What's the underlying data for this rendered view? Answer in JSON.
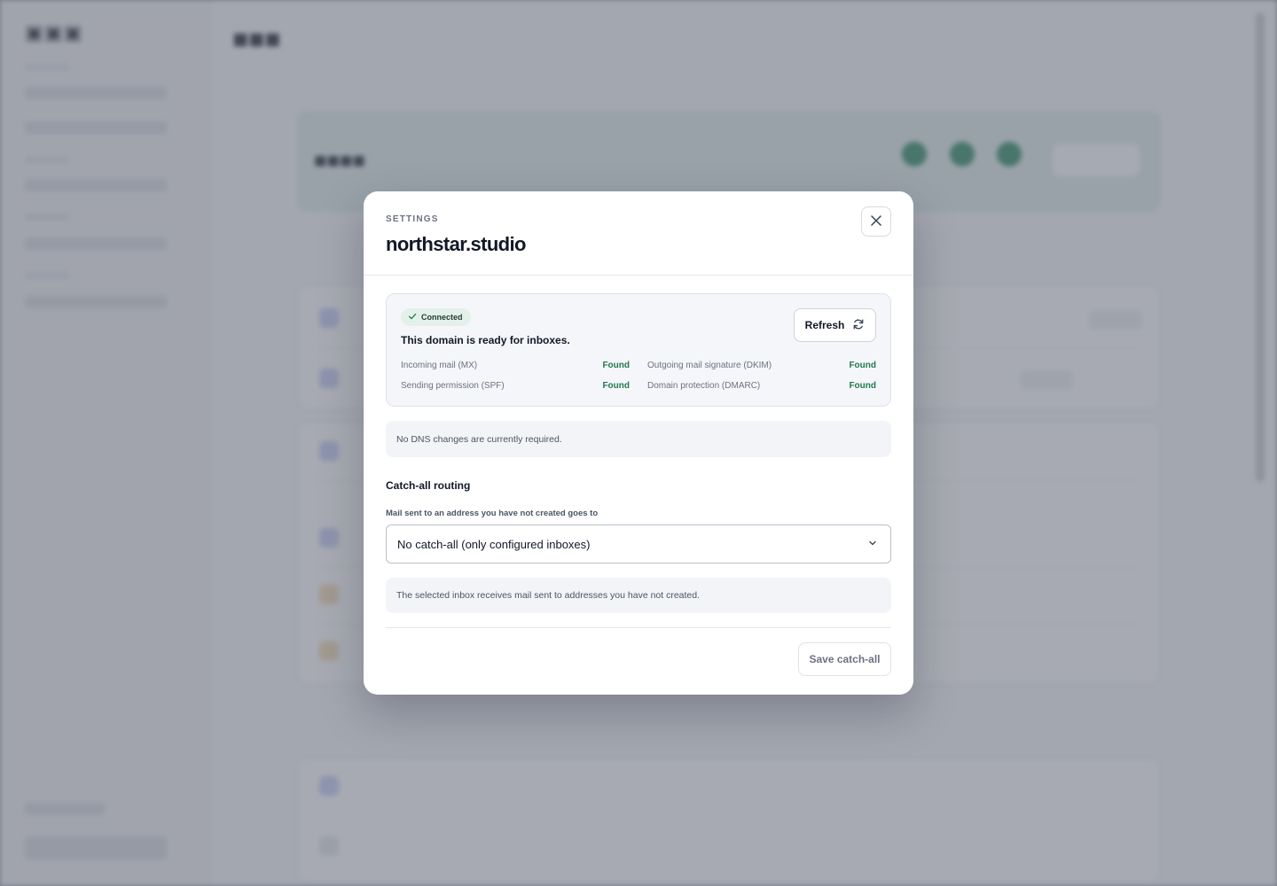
{
  "modal": {
    "eyebrow": "SETTINGS",
    "title": "northstar.studio",
    "close_icon": "close-icon"
  },
  "status": {
    "badge": "Connected",
    "badge_icon": "check-icon",
    "headline": "This domain is ready for inboxes.",
    "refresh_label": "Refresh",
    "refresh_icon": "refresh-icon",
    "checks": [
      {
        "label": "Incoming mail (MX)",
        "value": "Found"
      },
      {
        "label": "Outgoing mail signature (DKIM)",
        "value": "Found"
      },
      {
        "label": "Sending permission (SPF)",
        "value": "Found"
      },
      {
        "label": "Domain protection (DMARC)",
        "value": "Found"
      }
    ]
  },
  "dns_note": "No DNS changes are currently required.",
  "catch_all": {
    "title": "Catch-all routing",
    "field_label": "Mail sent to an address you have not created goes to",
    "selected": "No catch-all (only configured inboxes)",
    "help": "The selected inbox receives mail sent to addresses you have not created.",
    "save_label": "Save catch-all"
  },
  "colors": {
    "accent_green": "#217a4c",
    "badge_bg": "#e3f1ea",
    "overlay": "#5f6473"
  }
}
